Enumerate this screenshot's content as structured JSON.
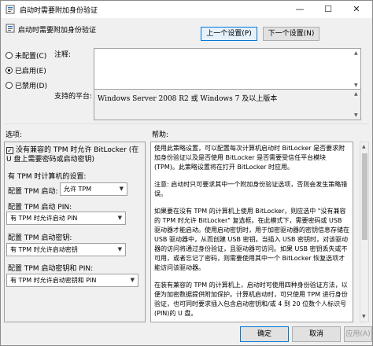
{
  "window": {
    "title": "启动时需要附加身份验证",
    "min": "—",
    "max": "☐",
    "close": "✕"
  },
  "header": {
    "title": "启动时需要附加身份验证"
  },
  "nav": {
    "prev": "上一个设置(P)",
    "next": "下一个设置(N)"
  },
  "state": {
    "options": [
      {
        "label": "未配置(C)",
        "selected": false
      },
      {
        "label": "已启用(E)",
        "selected": true
      },
      {
        "label": "已禁用(D)",
        "selected": false
      }
    ]
  },
  "comment": {
    "label": "注释:",
    "value": ""
  },
  "platform": {
    "label": "支持的平台:",
    "value": "Windows Server 2008 R2 或 Windows 7 及以上版本"
  },
  "sections": {
    "options": "选项:",
    "help": "帮助:"
  },
  "options_pane": {
    "checkbox_label": "没有兼容的 TPM 时允许 BitLocker (在 U 盘上需要密码或启动密钥)",
    "tpm_computer_label": "有 TPM 时计算机的设置:",
    "tpm_startup_label": "配置 TPM 启动:",
    "tpm_startup_value": "允许 TPM",
    "tpm_pin_label": "配置 TPM 启动 PIN:",
    "tpm_pin_value": "有 TPM 时允许启动 PIN",
    "tpm_key_label": "配置 TPM 启动密钥:",
    "tpm_key_value": "有 TPM 时允许启动密钥",
    "tpm_key_pin_label": "配置 TPM 启动密钥和 PIN:",
    "tpm_key_pin_value": "有 TPM 时允许启动密钥和 PIN"
  },
  "help": {
    "p1": "使用此策略设置，可以配置每次计算机启动时 BitLocker 是否要求附加身份验证以及是否使用 BitLocker 是否需要受信任平台模块(TPM)。此策略设置将在打开 BitLocker 时应用。",
    "p2": "注意: 启动时只可要求其中一个附加身份验证选项，否则会发生策略错误。",
    "p3": "如果要在没有 TPM 的计算机上使用 BitLocker，则应选中 \"没有兼容的 TPM 时允许 BitLocker\" 复选框。在此模式下，需要密码或 USB 驱动器才能启动。使用启动密钥时，用于加密驱动器的密钥信息存储在 USB 驱动器中，从而创建 USB 密钥。当插入 USB 密钥时，对该驱动器的访问将通过身份验证，且驱动器可访问。如果 USB 密钥丢失或不可用，或者忘记了密码，则需要使用其中一个 BitLocker 恢复选项才能访问该驱动器。",
    "p4": "在装有兼容的 TPM 的计算机上，启动时可使用四种身份验证方法，以便为加密数据提供附加保护。计算机启动时，可只使用 TPM 进行身份验证，也可同时要求插入包含启动密钥和/或 4 到 20 位数个人标识号(PIN)的 U 盘。"
  },
  "footer": {
    "ok": "确定",
    "cancel": "取消",
    "apply": "应用(A)"
  }
}
